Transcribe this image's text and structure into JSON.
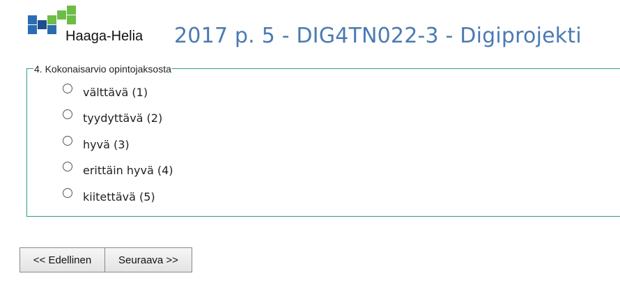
{
  "header": {
    "logo_text": "Haaga-Helia",
    "title": "2017 p. 5 - DIG4TN022-3 - Digiprojekti"
  },
  "colors": {
    "title": "#4a7ab3",
    "fieldset_border": "#2f9a8c",
    "logo_blue": "#2b6cb0",
    "logo_green": "#6cbd45",
    "logo_dark_blue": "#1e4e8c"
  },
  "question": {
    "legend": "4. Kokonaisarvio opintojaksosta",
    "options": [
      {
        "label": "välttävä (1)",
        "selected": false
      },
      {
        "label": "tyydyttävä (2)",
        "selected": false
      },
      {
        "label": "hyvä (3)",
        "selected": false
      },
      {
        "label": "erittäin hyvä (4)",
        "selected": false
      },
      {
        "label": "kiitettävä (5)",
        "selected": false
      }
    ]
  },
  "nav": {
    "prev_label": "<< Edellinen",
    "next_label": "Seuraava >>"
  },
  "icons": {
    "logo": "haaga-helia-logo-icon"
  }
}
